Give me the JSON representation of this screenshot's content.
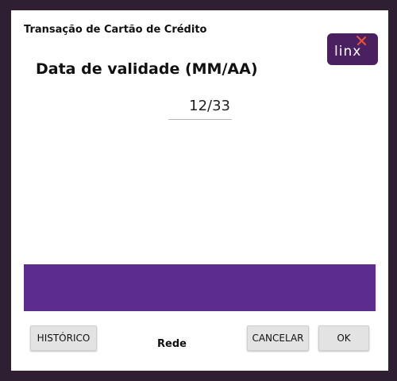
{
  "window": {
    "title": "Transação de Cartão de Crédito"
  },
  "logo": {
    "text": "linx",
    "background": "#4a2060",
    "accent": "#e8503a"
  },
  "form": {
    "label": "Data de validade (MM/AA)",
    "value": "12/33"
  },
  "status_bar": {
    "color": "#5c2d8e"
  },
  "footer": {
    "history_label": "HISTÓRICO",
    "network_label": "Rede",
    "cancel_label": "CANCELAR",
    "ok_label": "OK"
  }
}
